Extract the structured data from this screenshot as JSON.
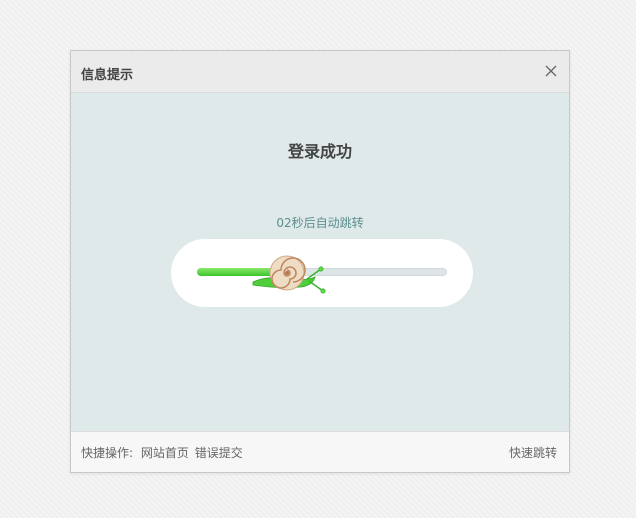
{
  "dialog": {
    "title": "信息提示",
    "message": "登录成功",
    "countdown": "02秒后自动跳转",
    "progress_fraction": 0.32
  },
  "footer": {
    "ops_label": "快捷操作:",
    "links": [
      "网站首页",
      "错误提交"
    ],
    "quick_jump": "快速跳转"
  },
  "icons": {
    "close": "close-icon",
    "snail": "snail-icon"
  },
  "colors": {
    "accent_green": "#3cc42b",
    "countdown_text": "#5b8f8f",
    "panel_bg": "#dfe9ea"
  }
}
